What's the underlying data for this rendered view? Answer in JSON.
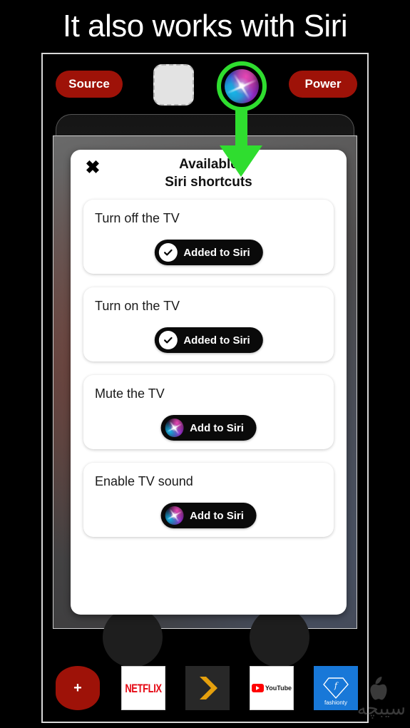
{
  "headline": "It also works with Siri",
  "remote": {
    "source_label": "Source",
    "power_label": "Power",
    "placeholder_button": "blank-key-placeholder",
    "siri_button": "siri-orb-button",
    "highlight_color": "#2fdd2f",
    "button_color": "#9e1208"
  },
  "annotation": {
    "type": "arrow",
    "color": "#2fdd2f",
    "points_to": "siri-orb-button",
    "direction": "down"
  },
  "modal": {
    "close_icon": "close-icon",
    "title_line1": "Available",
    "title_line2": "Siri shortcuts",
    "shortcuts": [
      {
        "title": "Turn off the TV",
        "button_label": "Added to Siri",
        "state": "added",
        "icon": "check-icon"
      },
      {
        "title": "Turn on the TV",
        "button_label": "Added to Siri",
        "state": "added",
        "icon": "check-icon"
      },
      {
        "title": "Mute the TV",
        "button_label": "Add to Siri",
        "state": "not-added",
        "icon": "siri-orb-icon"
      },
      {
        "title": "Enable TV sound",
        "button_label": "Add to Siri",
        "state": "not-added",
        "icon": "siri-orb-icon"
      }
    ]
  },
  "apps": [
    {
      "name": "add-app",
      "label": "+",
      "type": "add"
    },
    {
      "name": "netflix",
      "label": "NETFLIX",
      "type": "netflix"
    },
    {
      "name": "plex",
      "label": "",
      "type": "plex"
    },
    {
      "name": "youtube",
      "label": "YouTube",
      "type": "youtube"
    },
    {
      "name": "fashionty",
      "label": "fashionty",
      "type": "fashionty"
    }
  ],
  "watermark": {
    "text": "سیبچه"
  }
}
